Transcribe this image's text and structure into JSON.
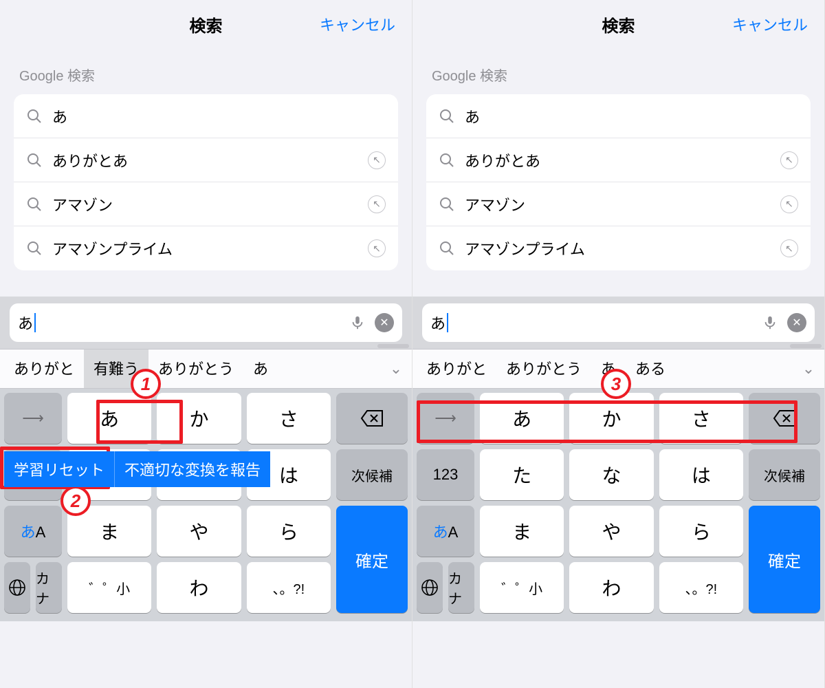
{
  "header": {
    "title": "検索",
    "cancel": "キャンセル"
  },
  "sectionLabel": "Google 検索",
  "suggestions": [
    {
      "text": "あ",
      "fill": false
    },
    {
      "text": "ありがとあ",
      "fill": true
    },
    {
      "text": "アマゾン",
      "fill": true
    },
    {
      "text": "アマゾンプライム",
      "fill": true
    }
  ],
  "searchField": {
    "typed": "あ"
  },
  "candidatesLeft": {
    "items": [
      "ありがと",
      "有難う",
      "ありがとう",
      "あ"
    ],
    "selectedIndex": 1
  },
  "candidatesRight": {
    "items": [
      "ありがと",
      "ありがとう",
      "あ",
      "ある"
    ],
    "selectedIndex": -1
  },
  "popup": {
    "reset": "学習リセット",
    "report": "不適切な変換を報告"
  },
  "keys": {
    "r1": {
      "c0": "→",
      "c1": "あ",
      "c2": "か",
      "c3": "さ",
      "c4": "⌫"
    },
    "r2": {
      "c0": "123",
      "c1": "た",
      "c2": "な",
      "c3": "は",
      "c4": "次候補"
    },
    "r3": {
      "c0": "あA",
      "c1": "ま",
      "c2": "や",
      "c3": "ら"
    },
    "r4": {
      "globe": "🌐",
      "kana": "カナ",
      "c1": "゛゜小",
      "c2": "わ",
      "c3": "、。?!",
      "confirm": "確定"
    }
  },
  "annotations": {
    "n1": "1",
    "n2": "2",
    "n3": "3"
  }
}
